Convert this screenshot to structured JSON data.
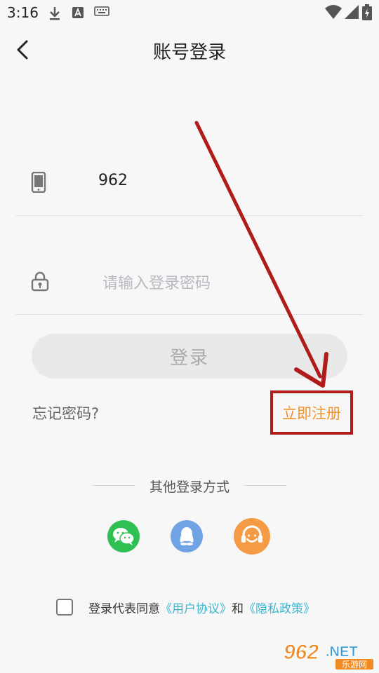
{
  "status_bar": {
    "time": "3:16",
    "left_icons": [
      "download-icon",
      "font-app-icon",
      "keyboard-icon"
    ],
    "right_icons": [
      "wifi-icon",
      "signal-icon",
      "battery-charging-icon"
    ]
  },
  "header": {
    "title": "账号登录",
    "back_icon": "chevron-left-icon"
  },
  "form": {
    "phone": {
      "icon": "phone-icon",
      "value": "962"
    },
    "password": {
      "icon": "lock-icon",
      "placeholder": "请输入登录密码"
    },
    "login_button": "登录",
    "forgot_password": "忘记密码?",
    "register": "立即注册"
  },
  "other_login": {
    "label": "其他登录方式",
    "methods": [
      "wechat-icon",
      "qq-icon",
      "customer-service-icon"
    ]
  },
  "agreement": {
    "prefix": "登录代表同意",
    "user_agreement": "《用户协议》",
    "and": "和",
    "privacy_policy": "《隐私政策》",
    "checked": false
  },
  "watermark": {
    "brand": "962.NET",
    "sub": "乐游网"
  },
  "colors": {
    "register": "#f0932b",
    "annotation": "#b01c1a",
    "link": "#3ab7cf",
    "wechat": "#2ec052",
    "qq": "#6fa3e4",
    "service": "#f59b45"
  }
}
